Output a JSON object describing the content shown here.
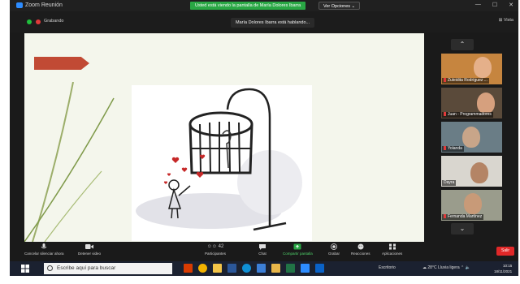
{
  "window": {
    "title": "Zoom Reunión",
    "share_banner": "Usted está viendo la pantalla de María Dolores Ibarra",
    "options_label": "Ver Opciones ⌄",
    "controls": [
      "—",
      "☐",
      "✕"
    ]
  },
  "subbar": {
    "recording_label": "Grabando",
    "speaking_label": "María Dolores Ibarra está hablando...",
    "view_label": "Vista"
  },
  "participants": [
    {
      "name": "Zuleidita Rodríguez ...",
      "bg": "#c6853f",
      "face": "#e5b08a"
    },
    {
      "name": "Juan - Programmadores",
      "bg": "#5a4a3a",
      "face": "#d6a07e"
    },
    {
      "name": "Yolanda",
      "bg": "#6a7d86",
      "face": "#c8a589"
    },
    {
      "name": "Dayra",
      "bg": "#d9d6cf",
      "face": "#b48465"
    },
    {
      "name": "Fernanda Martínez",
      "bg": "#9a9c8c",
      "face": "#c89a78"
    }
  ],
  "toolbar": {
    "mute_label": "Cancelar silenciar ahora",
    "video_label": "Detener video",
    "participants_label": "Participantes",
    "participants_count": "42",
    "chat_label": "Chat",
    "share_label": "Compartir pantalla",
    "record_label": "Grabar",
    "reactions_label": "Reacciones",
    "apps_label": "Aplicaciones",
    "leave_label": "Salir"
  },
  "taskbar": {
    "search_placeholder": "Escribe aquí para buscar",
    "tray_label": "Escritorio",
    "weather": "28°C  Lluvia ligera",
    "time": "10:15",
    "date": "18/11/2021"
  },
  "colors": {
    "zoom_green": "#29a744",
    "leave_red": "#e02828",
    "slide_arrow": "#c14a34",
    "slide_bg": "#f4f6ec"
  }
}
